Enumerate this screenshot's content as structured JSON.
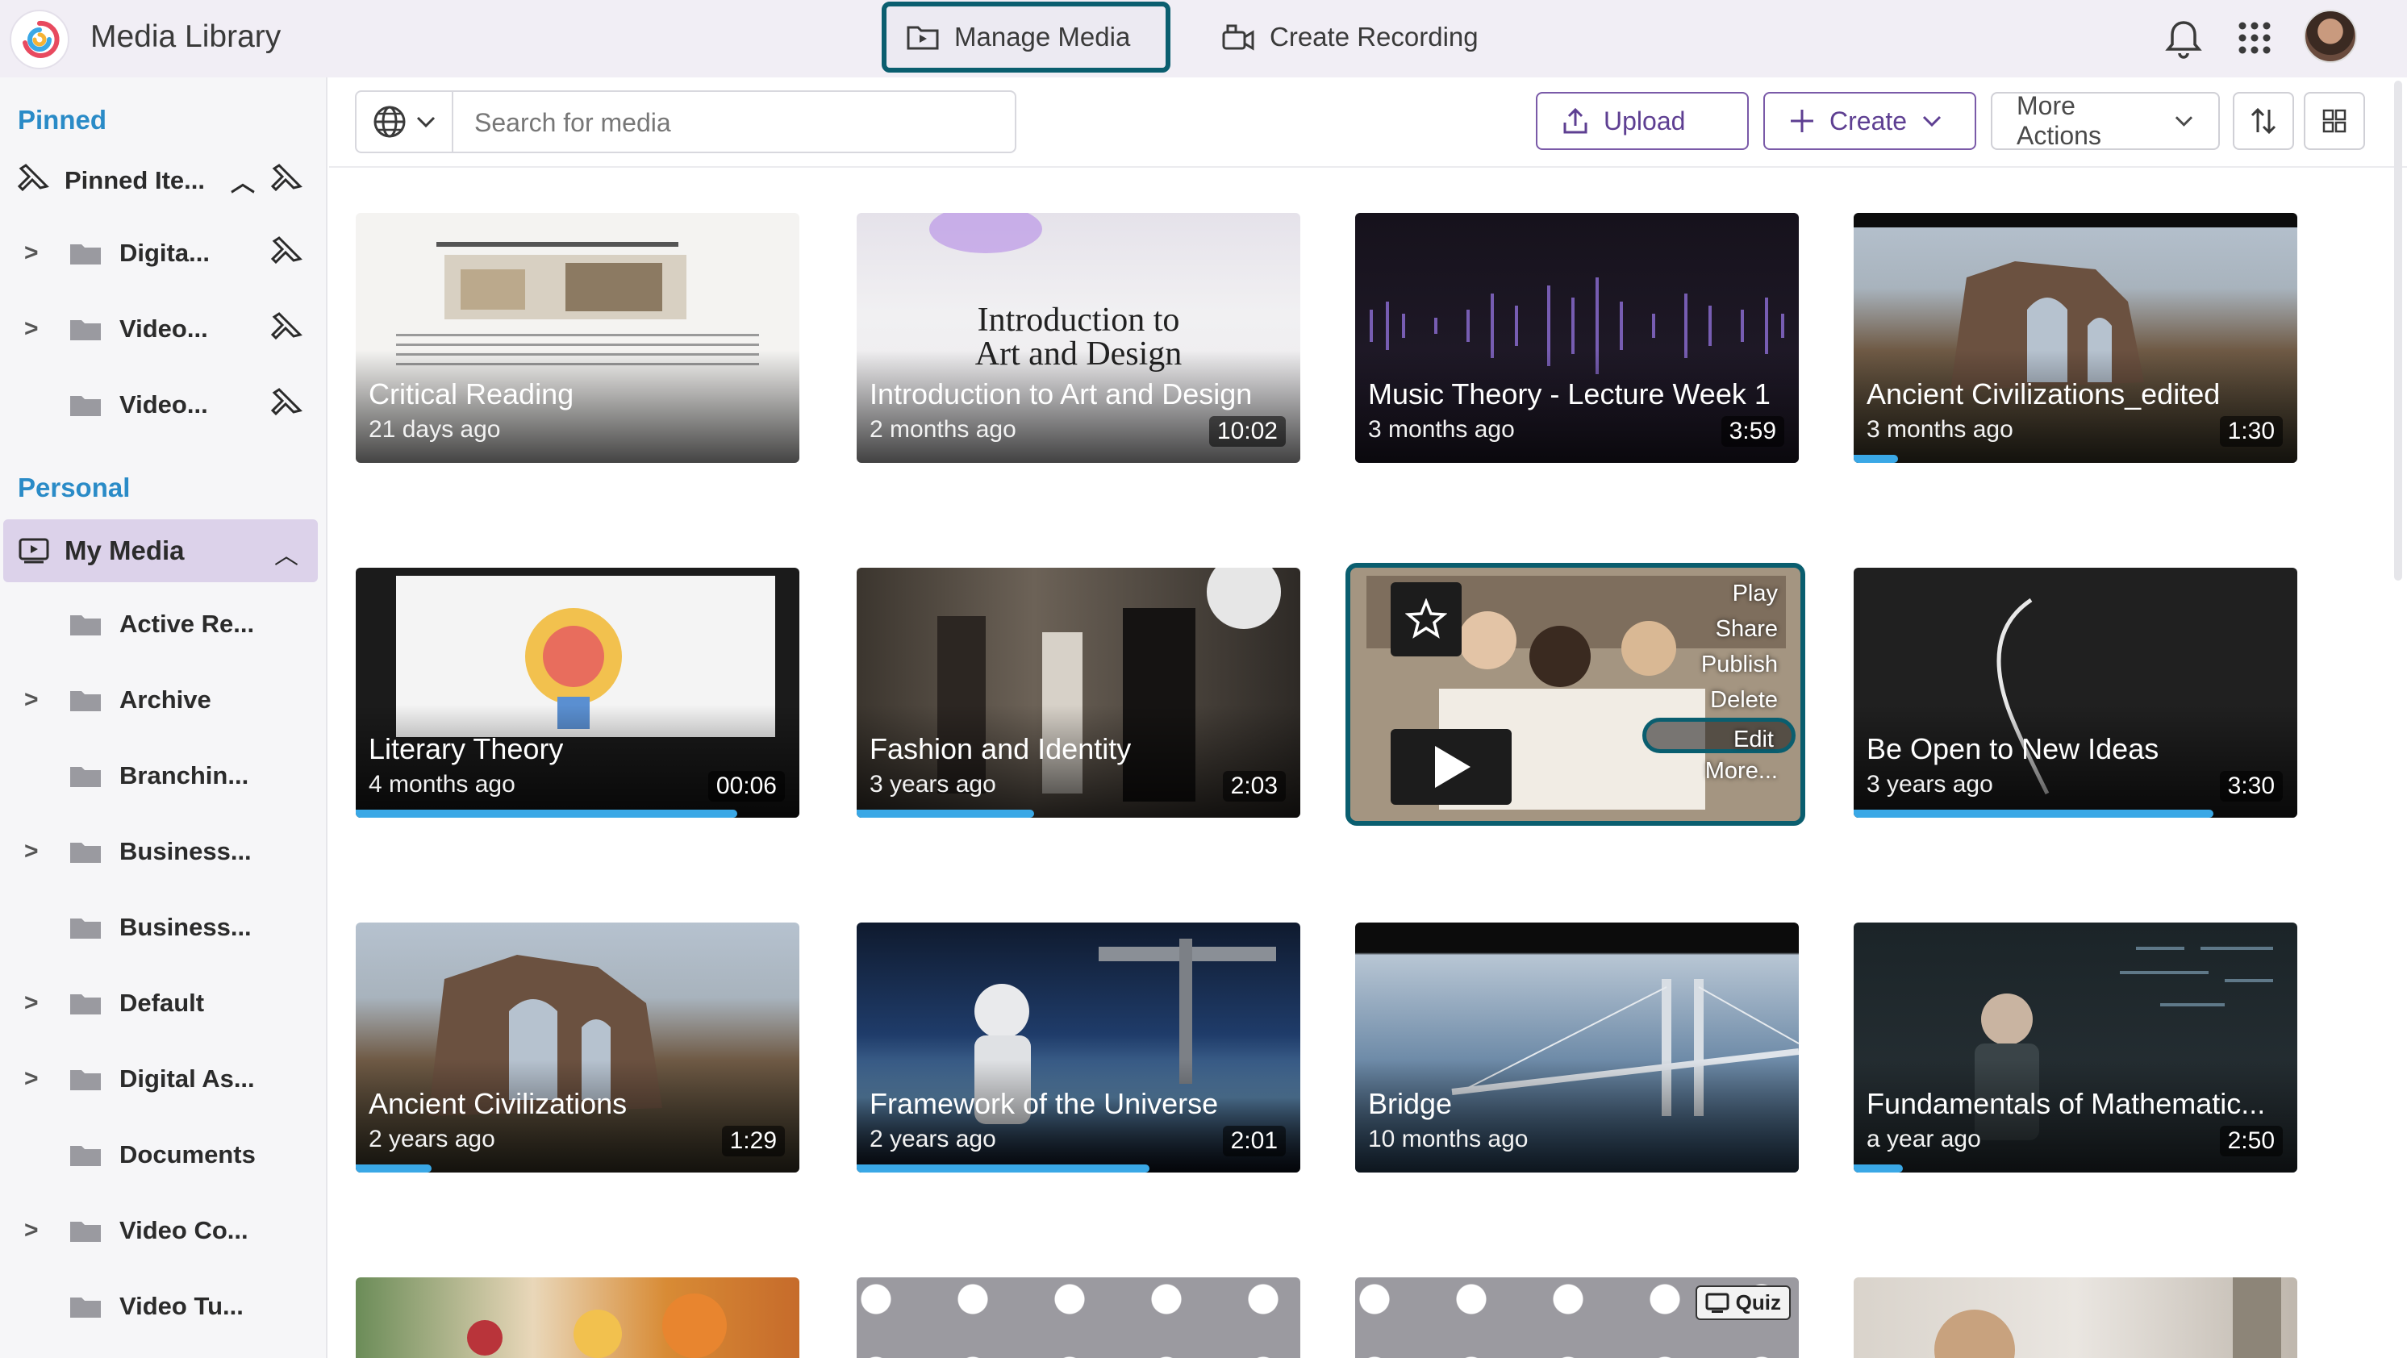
{
  "app": {
    "title": "Media Library"
  },
  "topnav": {
    "tabs": [
      {
        "label": "Manage Media",
        "active": true
      },
      {
        "label": "Create Recording",
        "active": false
      }
    ]
  },
  "sidebar": {
    "pinned_title": "Pinned",
    "pinned_header": "Pinned Ite...",
    "pinned_items": [
      {
        "label": "Digita...",
        "expandable": true
      },
      {
        "label": "Video...",
        "expandable": true
      },
      {
        "label": "Video...",
        "expandable": false
      }
    ],
    "personal_title": "Personal",
    "my_media": "My Media",
    "folders": [
      {
        "label": "Active Re...",
        "expandable": false
      },
      {
        "label": "Archive",
        "expandable": true
      },
      {
        "label": "Branchin...",
        "expandable": false
      },
      {
        "label": "Business...",
        "expandable": true
      },
      {
        "label": "Business...",
        "expandable": false
      },
      {
        "label": "Default",
        "expandable": true
      },
      {
        "label": "Digital As...",
        "expandable": true
      },
      {
        "label": "Documents",
        "expandable": false
      },
      {
        "label": "Video Co...",
        "expandable": true
      },
      {
        "label": "Video Tu...",
        "expandable": false
      }
    ]
  },
  "toolbar": {
    "search_placeholder": "Search for media",
    "upload_label": "Upload",
    "create_label": "Create",
    "more_actions_label": "More Actions"
  },
  "media": [
    {
      "title": "Critical Reading",
      "date": "21 days ago",
      "duration": "",
      "progress": 0,
      "thumb": "paper",
      "overlay_text_line1": "",
      "overlay_text_line2": ""
    },
    {
      "title": "Introduction to Art and Design",
      "date": "2 months ago",
      "duration": "10:02",
      "progress": 0,
      "thumb": "art",
      "overlay_text_line1": "Introduction to",
      "overlay_text_line2": "Art and Design"
    },
    {
      "title": "Music Theory - Lecture Week 1",
      "date": "3 months ago",
      "duration": "3:59",
      "progress": 0,
      "thumb": "music"
    },
    {
      "title": "Ancient Civilizations_edited",
      "date": "3 months ago",
      "duration": "1:30",
      "progress": 0.1,
      "thumb": "ruins"
    },
    {
      "title": "Literary Theory",
      "date": "4 months ago",
      "duration": "00:06",
      "progress": 0.86,
      "thumb": "lit"
    },
    {
      "title": "Fashion and Identity",
      "date": "3 years ago",
      "duration": "2:03",
      "progress": 0.4,
      "thumb": "fashion"
    },
    {
      "title": "",
      "date": "",
      "duration": "",
      "progress": 0,
      "thumb": "class",
      "selected": true
    },
    {
      "title": "Be Open to New Ideas",
      "date": "3 years ago",
      "duration": "3:30",
      "progress": 0.81,
      "thumb": "dark"
    },
    {
      "title": "Ancient Civilizations",
      "date": "2 years ago",
      "duration": "1:29",
      "progress": 0.17,
      "thumb": "ruins"
    },
    {
      "title": "Framework of the Universe",
      "date": "2 years ago",
      "duration": "2:01",
      "progress": 0.66,
      "thumb": "space"
    },
    {
      "title": "Bridge",
      "date": "10 months ago",
      "duration": "",
      "progress": 0,
      "thumb": "bridge"
    },
    {
      "title": "Fundamentals of Mathematic...",
      "date": "a year ago",
      "duration": "2:50",
      "progress": 0.11,
      "thumb": "math"
    },
    {
      "title": "",
      "date": "",
      "duration": "",
      "progress": 0,
      "thumb": "fruit"
    },
    {
      "title": "",
      "date": "",
      "duration": "",
      "progress": 0,
      "thumb": "dots"
    },
    {
      "title": "",
      "date": "",
      "duration": "",
      "progress": 0,
      "thumb": "dots",
      "badge": "Quiz"
    },
    {
      "title": "",
      "date": "",
      "duration": "",
      "progress": 0,
      "thumb": "person"
    }
  ],
  "context_menu": {
    "items": [
      "Play",
      "Share",
      "Publish",
      "Delete",
      "Edit",
      "More..."
    ],
    "focused": "Edit"
  },
  "colors": {
    "accent": "#0a5e6f",
    "purple": "#5e3f92",
    "section_blue": "#2a8bc7",
    "selected_bg": "#dcd2ea",
    "progress": "#3aa8e6"
  }
}
